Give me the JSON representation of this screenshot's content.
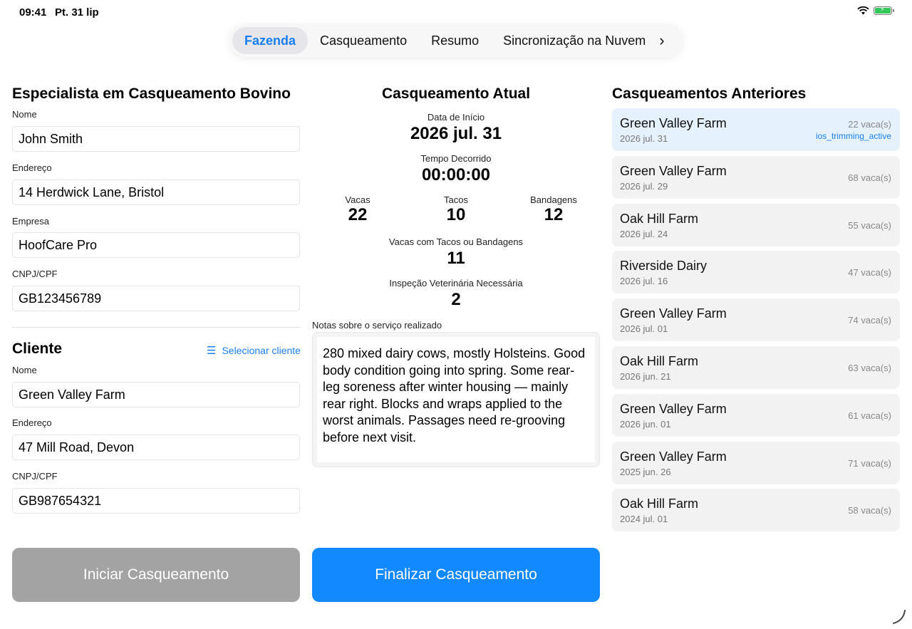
{
  "status": {
    "time": "09:41",
    "date": "Pt. 31 lip"
  },
  "tabs": [
    {
      "label": "Fazenda",
      "active": true
    },
    {
      "label": "Casqueamento",
      "active": false
    },
    {
      "label": "Resumo",
      "active": false
    },
    {
      "label": "Sincronização na Nuvem",
      "active": false
    }
  ],
  "specialist": {
    "heading": "Especialista em Casqueamento Bovino",
    "name_label": "Nome",
    "name": "John Smith",
    "address_label": "Endereço",
    "address": "14 Herdwick Lane, Bristol",
    "company_label": "Empresa",
    "company": "HoofCare Pro",
    "tax_label": "CNPJ/CPF",
    "tax": "GB123456789"
  },
  "client": {
    "heading": "Cliente",
    "select_label": "Selecionar cliente",
    "name_label": "Nome",
    "name": "Green Valley Farm",
    "address_label": "Endereço",
    "address": "47 Mill Road, Devon",
    "tax_label": "CNPJ/CPF",
    "tax": "GB987654321"
  },
  "current": {
    "heading": "Casqueamento Atual",
    "start_label": "Data de Início",
    "start": "2026 jul. 31",
    "elapsed_label": "Tempo Decorrido",
    "elapsed": "00:00:00",
    "cows_label": "Vacas",
    "cows": "22",
    "blocks_label": "Tacos",
    "blocks": "10",
    "bandages_label": "Bandagens",
    "bandages": "12",
    "treated_label": "Vacas com Tacos ou Bandagens",
    "treated": "11",
    "vet_label": "Inspeção Veterinária Necessária",
    "vet": "2",
    "notes_label": "Notas sobre o serviço realizado",
    "notes": "280 mixed dairy cows, mostly Holsteins. Good body condition going into spring. Some rear-leg soreness after winter housing — mainly rear right. Blocks and wraps applied to the worst animals. Passages need re-grooving before next visit."
  },
  "buttons": {
    "start": "Iniciar Casqueamento",
    "finish": "Finalizar Casqueamento"
  },
  "previous": {
    "heading": "Casqueamentos Anteriores",
    "items": [
      {
        "name": "Green Valley Farm",
        "date": "2026 jul. 31",
        "count": "22 vaca(s)",
        "tag": "ios_trimming_active"
      },
      {
        "name": "Green Valley Farm",
        "date": "2026 jul. 29",
        "count": "68 vaca(s)"
      },
      {
        "name": "Oak Hill Farm",
        "date": "2026 jul. 24",
        "count": "55 vaca(s)"
      },
      {
        "name": "Riverside Dairy",
        "date": "2026 jul. 16",
        "count": "47 vaca(s)"
      },
      {
        "name": "Green Valley Farm",
        "date": "2026 jul. 01",
        "count": "74 vaca(s)"
      },
      {
        "name": "Oak Hill Farm",
        "date": "2026 jun. 21",
        "count": "63 vaca(s)"
      },
      {
        "name": "Green Valley Farm",
        "date": "2026 jun. 01",
        "count": "61 vaca(s)"
      },
      {
        "name": "Green Valley Farm",
        "date": "2025 jun. 26",
        "count": "71 vaca(s)"
      },
      {
        "name": "Oak Hill Farm",
        "date": "2024 jul. 01",
        "count": "58 vaca(s)"
      }
    ]
  },
  "colors": {
    "accent": "#1a7ff0",
    "finish_button": "#1289ff",
    "start_button": "#a3a3a3"
  }
}
